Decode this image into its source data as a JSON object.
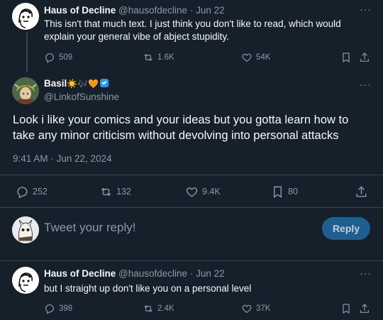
{
  "tweet1": {
    "name": "Haus of Decline",
    "handle": "@hausofdecline",
    "date": "Jun 22",
    "text": "This isn't that much text. I just think you don't like to read, which would explain your general vibe of abject stupidity.",
    "replies": "509",
    "retweets": "1.6K",
    "likes": "54K"
  },
  "main_tweet": {
    "name": "Basil",
    "name_emojis": "☀️🎶🧡",
    "handle": "@LinkofSunshine",
    "text": "Look i like your comics and your ideas but you gotta learn how to take any minor criticism without devolving into personal attacks",
    "timestamp": "9:41 AM · Jun 22, 2024",
    "replies": "252",
    "retweets": "132",
    "likes": "9.4K",
    "bookmarks": "80"
  },
  "reply_box": {
    "placeholder": "Tweet your reply!",
    "button_label": "Reply"
  },
  "tweet3": {
    "name": "Haus of Decline",
    "handle": "@hausofdecline",
    "date": "Jun 22",
    "text": "but I straight up don't like you on a personal level",
    "replies": "398",
    "retweets": "2.4K",
    "likes": "37K"
  },
  "more_glyph": "···",
  "separator": "·",
  "colors": {
    "background": "#15202b",
    "text": "#f7f9f9",
    "muted": "#8b98a5",
    "divider": "#38444d",
    "reply_button": "#1d6090",
    "verified": "#1d9bf0"
  }
}
